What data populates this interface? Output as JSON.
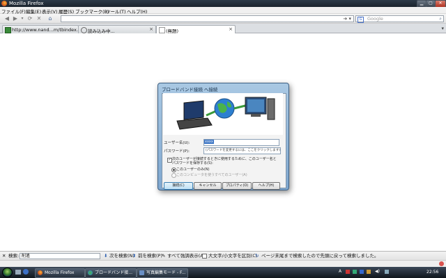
{
  "window": {
    "title": "Mozilla Firefox"
  },
  "menu": [
    "ファイル(F)",
    "編集(E)",
    "表示(V)",
    "履歴(S)",
    "ブックマーク(B)",
    "ツール(T)",
    "ヘルプ(H)"
  ],
  "search": {
    "placeholder": "Google"
  },
  "tabs": [
    {
      "label": "http://www.nand...m/tbindex.cgi"
    },
    {
      "label": "読み込み中..."
    },
    {
      "label": "(無題)"
    }
  ],
  "dialog": {
    "title": "ブロードバンド接続 へ接続",
    "username_label": "ユーザー名(U):",
    "username_value": "xxxx",
    "password_label": "パスワード(P):",
    "password_placeholder": "(パスワードを変更するには、ここをクリックします)",
    "save_label": "次のユーザーが接続するときに使用するために、このユーザー名とパスワードを保存する(S):",
    "only_me": "このユーザーのみ(N)",
    "anyone": "このコンピュータを使うすべてのユーザー(A)",
    "buttons": {
      "connect": "接続(C)",
      "cancel": "キャンセル",
      "properties": "プロパティ(O)",
      "help": "ヘルプ(H)"
    }
  },
  "findbar": {
    "label": "検索:",
    "value": "削遙",
    "next": "次を検索(N)",
    "prev": "前を検索(P)",
    "highlight": "すべて強調表示(A)",
    "matchcase": "大文字/小文字を区別(C)",
    "status": "ページ末尾まで検索したので先頭に戻って検索しました。"
  },
  "taskbar": {
    "items": [
      "Mozilla Firefox",
      "ブロードバンド接...",
      "写真編集モード - F..."
    ],
    "clock": "22:56"
  }
}
